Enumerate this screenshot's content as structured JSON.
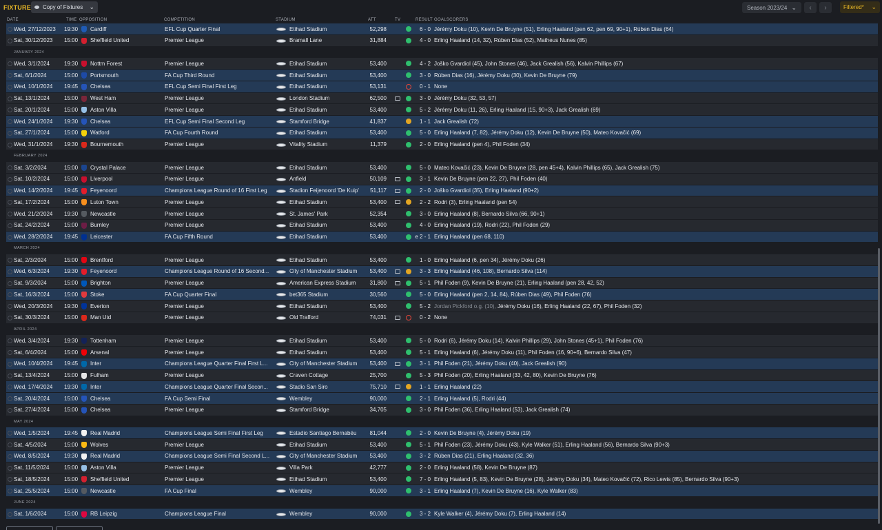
{
  "header": {
    "title": "FIXTURES",
    "view_label": "Copy of Fixtures",
    "season_label": "Season 2023/24",
    "prev_icon": "chevron-left-icon",
    "next_icon": "chevron-right-icon",
    "filter_label": "Filtered*"
  },
  "columns": {
    "date": "DATE",
    "time": "TIME",
    "opposition": "OPPOSITION",
    "competition": "COMPETITION",
    "stadium": "STADIUM",
    "att": "ATT",
    "tv": "TV",
    "result": "RESULT",
    "goalscorers": "GOALSCORERS"
  },
  "colors": {
    "accent": "#e7b726",
    "win": "#2fbf6e",
    "draw": "#e3a623",
    "loss": "#e2473b",
    "row": "#26292f",
    "row_highlight": "#243a56"
  },
  "rows": [
    {
      "kind": "fixture",
      "date": "Wed, 27/12/2023",
      "time": "19:30",
      "opp": "Cardiff",
      "crest": "#1f5bb5",
      "comp": "EFL Cup Quarter Final",
      "stad": "Etihad Stadium",
      "att": "52,298",
      "tv": false,
      "res": "W",
      "score": "6 - 0",
      "scorers": "Jérémy Doku (10), Kevin De Bruyne (51), Erling Haaland (pen 62, pen 69, 90+1), Rúben Dias (64)",
      "hl": true
    },
    {
      "kind": "fixture",
      "date": "Sat, 30/12/2023",
      "time": "15:00",
      "opp": "Sheffield United",
      "crest": "#d3202f",
      "comp": "Premier League",
      "stad": "Bramall Lane",
      "att": "31,884",
      "tv": false,
      "res": "W",
      "score": "4 - 0",
      "scorers": "Erling Haaland (14, 32), Rúben Dias (52), Matheus Nunes (85)",
      "hl": false
    },
    {
      "kind": "section",
      "label": "JANUARY 2024"
    },
    {
      "kind": "fixture",
      "date": "Wed, 3/1/2024",
      "time": "19:30",
      "opp": "Nottm Forest",
      "crest": "#c8102e",
      "comp": "Premier League",
      "stad": "Etihad Stadium",
      "att": "53,400",
      "tv": false,
      "res": "W",
      "score": "4 - 2",
      "scorers": "Joško Gvardiol (45), John Stones (46), Jack Grealish (56), Kalvin Phillips (67)",
      "hl": false
    },
    {
      "kind": "fixture",
      "date": "Sat, 6/1/2024",
      "time": "15:00",
      "opp": "Portsmouth",
      "crest": "#1d4aa7",
      "comp": "FA Cup Third Round",
      "stad": "Etihad Stadium",
      "att": "53,400",
      "tv": false,
      "res": "W",
      "score": "3 - 0",
      "scorers": "Rúben Dias (16), Jérémy Doku (30), Kevin De Bruyne (79)",
      "hl": true
    },
    {
      "kind": "fixture",
      "date": "Wed, 10/1/2024",
      "time": "19:45",
      "opp": "Chelsea",
      "crest": "#2554b8",
      "comp": "EFL Cup Semi Final First Leg",
      "stad": "Etihad Stadium",
      "att": "53,131",
      "tv": false,
      "res": "L",
      "score": "0 - 1",
      "scorers": "None",
      "hl": true
    },
    {
      "kind": "fixture",
      "date": "Sat, 13/1/2024",
      "time": "15:00",
      "opp": "West Ham",
      "crest": "#7a263a",
      "comp": "Premier League",
      "stad": "London Stadium",
      "att": "62,500",
      "tv": true,
      "res": "W",
      "score": "3 - 0",
      "scorers": "Jérémy Doku (32, 53, 57)",
      "hl": false
    },
    {
      "kind": "fixture",
      "date": "Sat, 20/1/2024",
      "time": "15:00",
      "opp": "Aston Villa",
      "crest": "#95bfe5",
      "comp": "Premier League",
      "stad": "Etihad Stadium",
      "att": "53,400",
      "tv": false,
      "res": "W",
      "score": "5 - 2",
      "scorers": "Jérémy Doku (11, 26), Erling Haaland (15, 90+3), Jack Grealish (69)",
      "hl": false
    },
    {
      "kind": "fixture",
      "date": "Wed, 24/1/2024",
      "time": "19:30",
      "opp": "Chelsea",
      "crest": "#2554b8",
      "comp": "EFL Cup Semi Final Second Leg",
      "stad": "Stamford Bridge",
      "att": "41,837",
      "tv": false,
      "res": "D",
      "score": "1 - 1",
      "scorers": "Jack Grealish (72)",
      "hl": true
    },
    {
      "kind": "fixture",
      "date": "Sat, 27/1/2024",
      "time": "15:00",
      "opp": "Watford",
      "crest": "#f5d20c",
      "comp": "FA Cup Fourth Round",
      "stad": "Etihad Stadium",
      "att": "53,400",
      "tv": false,
      "res": "W",
      "score": "5 - 0",
      "scorers": "Erling Haaland (7, 82), Jérémy Doku (12), Kevin De Bruyne (50), Mateo Kovačić (69)",
      "hl": true
    },
    {
      "kind": "fixture",
      "date": "Wed, 31/1/2024",
      "time": "19:30",
      "opp": "Bournemouth",
      "crest": "#da291c",
      "comp": "Premier League",
      "stad": "Vitality Stadium",
      "att": "11,379",
      "tv": false,
      "res": "W",
      "score": "2 - 0",
      "scorers": "Erling Haaland (pen 4), Phil Foden (34)",
      "hl": false
    },
    {
      "kind": "section",
      "label": "FEBRUARY 2024"
    },
    {
      "kind": "fixture",
      "date": "Sat, 3/2/2024",
      "time": "15:00",
      "opp": "Crystal Palace",
      "crest": "#1b458f",
      "comp": "Premier League",
      "stad": "Etihad Stadium",
      "att": "53,400",
      "tv": false,
      "res": "W",
      "score": "5 - 0",
      "scorers": "Mateo Kovačić (23), Kevin De Bruyne (28, pen 45+4), Kalvin Phillips (65), Jack Grealish (75)",
      "hl": false
    },
    {
      "kind": "fixture",
      "date": "Sat, 10/2/2024",
      "time": "15:00",
      "opp": "Liverpool",
      "crest": "#c8102e",
      "comp": "Premier League",
      "stad": "Anfield",
      "att": "50,109",
      "tv": true,
      "res": "W",
      "score": "3 - 1",
      "scorers": "Kevin De Bruyne (pen 22, 27), Phil Foden (40)",
      "hl": false
    },
    {
      "kind": "fixture",
      "date": "Wed, 14/2/2024",
      "time": "19:45",
      "opp": "Feyenoord",
      "crest": "#e41d2a",
      "comp": "Champions League Round of 16  First Leg",
      "stad": "Stadion Feijenoord 'De Kuip'",
      "att": "51,117",
      "tv": true,
      "res": "W",
      "score": "2 - 0",
      "scorers": "Joško Gvardiol (35), Erling Haaland (90+2)",
      "hl": true
    },
    {
      "kind": "fixture",
      "date": "Sat, 17/2/2024",
      "time": "15:00",
      "opp": "Luton Town",
      "crest": "#f78f1e",
      "comp": "Premier League",
      "stad": "Etihad Stadium",
      "att": "53,400",
      "tv": true,
      "res": "D",
      "score": "2 - 2",
      "scorers": "Rodri (3), Erling Haaland (pen 54)",
      "hl": false
    },
    {
      "kind": "fixture",
      "date": "Wed, 21/2/2024",
      "time": "19:30",
      "opp": "Newcastle",
      "crest": "#555a60",
      "comp": "Premier League",
      "stad": "St. James' Park",
      "att": "52,354",
      "tv": false,
      "res": "W",
      "score": "3 - 0",
      "scorers": "Erling Haaland (8), Bernardo Silva (66, 90+1)",
      "hl": false
    },
    {
      "kind": "fixture",
      "date": "Sat, 24/2/2024",
      "time": "15:00",
      "opp": "Burnley",
      "crest": "#6c1d45",
      "comp": "Premier League",
      "stad": "Etihad Stadium",
      "att": "53,400",
      "tv": false,
      "res": "W",
      "score": "4 - 0",
      "scorers": "Erling Haaland (19), Rodri (22), Phil Foden (29)",
      "hl": false
    },
    {
      "kind": "fixture",
      "date": "Wed, 28/2/2024",
      "time": "19:45",
      "opp": "Leicester",
      "crest": "#003090",
      "comp": "FA Cup Fifth Round",
      "stad": "Etihad Stadium",
      "att": "53,400",
      "tv": false,
      "res": "W",
      "score": "e 2 - 1",
      "scorers": "Erling Haaland (pen 68, 110)",
      "hl": true
    },
    {
      "kind": "section",
      "label": "MARCH 2024"
    },
    {
      "kind": "fixture",
      "date": "Sat, 2/3/2024",
      "time": "15:00",
      "opp": "Brentford",
      "crest": "#e30613",
      "comp": "Premier League",
      "stad": "Etihad Stadium",
      "att": "53,400",
      "tv": false,
      "res": "W",
      "score": "1 - 0",
      "scorers": "Erling Haaland (6, pen 34), Jérémy Doku (26)",
      "hl": false
    },
    {
      "kind": "fixture",
      "date": "Wed, 6/3/2024",
      "time": "19:30",
      "opp": "Feyenoord",
      "crest": "#e41d2a",
      "comp": "Champions League Round of 16  Second...",
      "stad": "City of Manchester Stadium",
      "att": "53,400",
      "tv": true,
      "res": "D",
      "score": "3 - 3",
      "scorers": "Erling Haaland (46, 108), Bernardo Silva (114)",
      "hl": true
    },
    {
      "kind": "fixture",
      "date": "Sat, 9/3/2024",
      "time": "15:00",
      "opp": "Brighton",
      "crest": "#0057b8",
      "comp": "Premier League",
      "stad": "American Express Stadium",
      "att": "31,800",
      "tv": true,
      "res": "W",
      "score": "5 - 1",
      "scorers": "Phil Foden (9), Kevin De Bruyne (21), Erling Haaland (pen 28, 42, 52)",
      "hl": false
    },
    {
      "kind": "fixture",
      "date": "Sat, 16/3/2024",
      "time": "15:00",
      "opp": "Stoke",
      "crest": "#e03a3e",
      "comp": "FA Cup Quarter Final",
      "stad": "bet365 Stadium",
      "att": "30,560",
      "tv": false,
      "res": "W",
      "score": "5 - 0",
      "scorers": "Erling Haaland (pen 2, 14, 84), Rúben Dias (49), Phil Foden (76)",
      "hl": true
    },
    {
      "kind": "fixture",
      "date": "Wed, 20/3/2024",
      "time": "19:30",
      "opp": "Everton",
      "crest": "#003399",
      "comp": "Premier League",
      "stad": "Etihad Stadium",
      "att": "53,400",
      "tv": false,
      "res": "W",
      "score": "5 - 2",
      "og": "Jordan Pickford o.g. (10),",
      "scorers": " Jérémy Doku (16), Erling Haaland (22, 67), Phil Foden (32)",
      "hl": false
    },
    {
      "kind": "fixture",
      "date": "Sat, 30/3/2024",
      "time": "15:00",
      "opp": "Man Utd",
      "crest": "#da291c",
      "comp": "Premier League",
      "stad": "Old Trafford",
      "att": "74,031",
      "tv": true,
      "res": "L",
      "score": "0 - 2",
      "scorers": "None",
      "hl": false
    },
    {
      "kind": "section",
      "label": "APRIL 2024"
    },
    {
      "kind": "fixture",
      "date": "Wed, 3/4/2024",
      "time": "19:30",
      "opp": "Tottenham",
      "crest": "#132257",
      "comp": "Premier League",
      "stad": "Etihad Stadium",
      "att": "53,400",
      "tv": false,
      "res": "W",
      "score": "5 - 0",
      "scorers": "Rodri (6), Jérémy Doku (14), Kalvin Phillips (29), John Stones (45+1), Phil Foden (76)",
      "hl": false
    },
    {
      "kind": "fixture",
      "date": "Sat, 6/4/2024",
      "time": "15:00",
      "opp": "Arsenal",
      "crest": "#ef0107",
      "comp": "Premier League",
      "stad": "Etihad Stadium",
      "att": "53,400",
      "tv": false,
      "res": "W",
      "score": "5 - 1",
      "scorers": "Erling Haaland (6), Jérémy Doku (11), Phil Foden (16, 90+6), Bernardo Silva (47)",
      "hl": false
    },
    {
      "kind": "fixture",
      "date": "Wed, 10/4/2024",
      "time": "19:45",
      "opp": "Inter",
      "crest": "#0068a8",
      "comp": "Champions League Quarter Final First L...",
      "stad": "City of Manchester Stadium",
      "att": "53,400",
      "tv": true,
      "res": "W",
      "score": "3 - 1",
      "scorers": "Phil Foden (21), Jérémy Doku (40), Jack Grealish (90)",
      "hl": true
    },
    {
      "kind": "fixture",
      "date": "Sat, 13/4/2024",
      "time": "15:00",
      "opp": "Fulham",
      "crest": "#e6e6e6",
      "comp": "Premier League",
      "stad": "Craven Cottage",
      "att": "25,700",
      "tv": false,
      "res": "W",
      "score": "5 - 3",
      "scorers": "Phil Foden (20), Erling Haaland (33, 42, 80), Kevin De Bruyne (76)",
      "hl": false
    },
    {
      "kind": "fixture",
      "date": "Wed, 17/4/2024",
      "time": "19:30",
      "opp": "Inter",
      "crest": "#0068a8",
      "comp": "Champions League Quarter Final Secon...",
      "stad": "Stadio San Siro",
      "att": "75,710",
      "tv": true,
      "res": "D",
      "score": "1 - 1",
      "scorers": "Erling Haaland (22)",
      "hl": true
    },
    {
      "kind": "fixture",
      "date": "Sat, 20/4/2024",
      "time": "15:00",
      "opp": "Chelsea",
      "crest": "#2554b8",
      "comp": "FA Cup Semi Final",
      "stad": "Wembley",
      "att": "90,000",
      "tv": false,
      "res": "W",
      "score": "2 - 1",
      "scorers": "Erling Haaland (5), Rodri (44)",
      "hl": true
    },
    {
      "kind": "fixture",
      "date": "Sat, 27/4/2024",
      "time": "15:00",
      "opp": "Chelsea",
      "crest": "#2554b8",
      "comp": "Premier League",
      "stad": "Stamford Bridge",
      "att": "34,705",
      "tv": false,
      "res": "W",
      "score": "3 - 0",
      "scorers": "Phil Foden (36), Erling Haaland (53), Jack Grealish (74)",
      "hl": false
    },
    {
      "kind": "section",
      "label": "MAY 2024"
    },
    {
      "kind": "fixture",
      "date": "Wed, 1/5/2024",
      "time": "19:45",
      "opp": "Real Madrid",
      "crest": "#f1f1f1",
      "comp": "Champions League Semi Final First Leg",
      "stad": "Estadio Santiago Bernabéu",
      "att": "81,044",
      "tv": false,
      "res": "W",
      "score": "2 - 0",
      "scorers": "Kevin De Bruyne (4), Jérémy Doku (19)",
      "hl": true
    },
    {
      "kind": "fixture",
      "date": "Sat, 4/5/2024",
      "time": "15:00",
      "opp": "Wolves",
      "crest": "#fdb913",
      "comp": "Premier League",
      "stad": "Etihad Stadium",
      "att": "53,400",
      "tv": false,
      "res": "W",
      "score": "5 - 1",
      "scorers": "Phil Foden (23), Jérémy Doku (43), Kyle Walker (51), Erling Haaland (56), Bernardo Silva (90+3)",
      "hl": false
    },
    {
      "kind": "fixture",
      "date": "Wed, 8/5/2024",
      "time": "19:30",
      "opp": "Real Madrid",
      "crest": "#f1f1f1",
      "comp": "Champions League Semi Final Second L...",
      "stad": "City of Manchester Stadium",
      "att": "53,400",
      "tv": false,
      "res": "W",
      "score": "3 - 2",
      "scorers": "Rúben Dias (21), Erling Haaland (32, 36)",
      "hl": true
    },
    {
      "kind": "fixture",
      "date": "Sat, 11/5/2024",
      "time": "15:00",
      "opp": "Aston Villa",
      "crest": "#95bfe5",
      "comp": "Premier League",
      "stad": "Villa Park",
      "att": "42,777",
      "tv": false,
      "res": "W",
      "score": "2 - 0",
      "scorers": "Erling Haaland (58), Kevin De Bruyne (87)",
      "hl": false
    },
    {
      "kind": "fixture",
      "date": "Sat, 18/5/2024",
      "time": "15:00",
      "opp": "Sheffield United",
      "crest": "#d3202f",
      "comp": "Premier League",
      "stad": "Etihad Stadium",
      "att": "53,400",
      "tv": false,
      "res": "W",
      "score": "7 - 0",
      "scorers": "Erling Haaland (5, 83), Kevin De Bruyne (28), Jérémy Doku (34), Mateo Kovačić (72), Rico Lewis (85), Bernardo Silva (90+3)",
      "hl": false
    },
    {
      "kind": "fixture",
      "date": "Sat, 25/5/2024",
      "time": "15:00",
      "opp": "Newcastle",
      "crest": "#555a60",
      "comp": "FA Cup Final",
      "stad": "Wembley",
      "att": "90,000",
      "tv": false,
      "res": "W",
      "score": "3 - 1",
      "scorers": "Erling Haaland (7), Kevin De Bruyne (16), Kyle Walker (83)",
      "hl": true
    },
    {
      "kind": "section",
      "label": "JUNE 2024"
    },
    {
      "kind": "fixture",
      "date": "Sat, 1/6/2024",
      "time": "15:00",
      "opp": "RB Leipzig",
      "crest": "#dd0741",
      "comp": "Champions League Final",
      "stad": "Wembley",
      "att": "90,000",
      "tv": false,
      "res": "W",
      "score": "3 - 2",
      "scorers": "Kyle Walker (4), Jérémy Doku (7), Erling Haaland (14)",
      "hl": true
    }
  ]
}
